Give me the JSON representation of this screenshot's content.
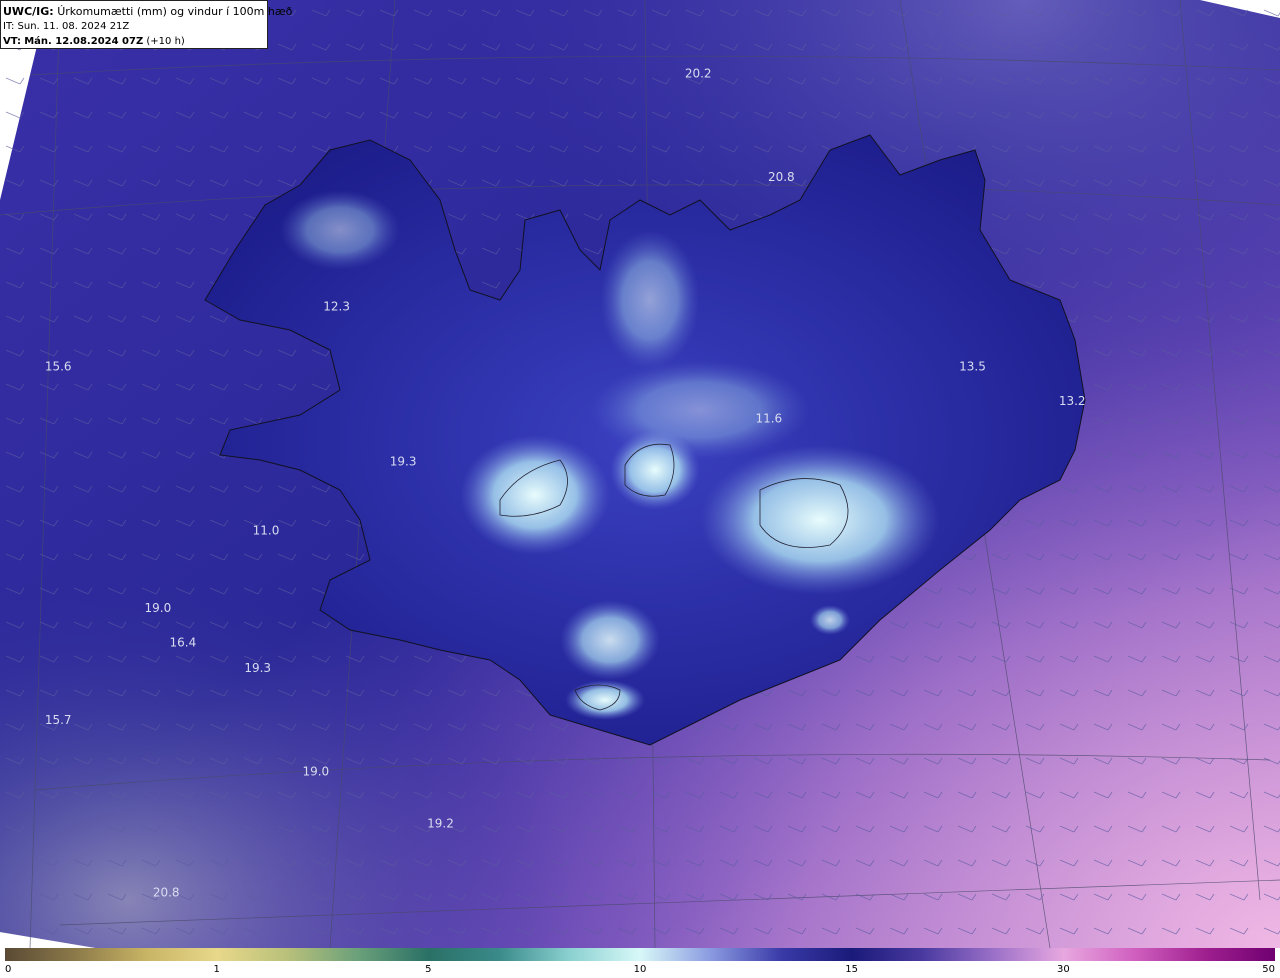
{
  "header": {
    "model": "UWC/IG:",
    "title": "Úrkomumætti (mm) og vindur í 100m hæð",
    "it_label": "IT:",
    "it_value": "Sun. 11. 08. 2024 21Z",
    "vt_label": "VT:",
    "vt_value": "Mán. 12.08.2024 07Z",
    "vt_offset": "(+10 h)"
  },
  "map": {
    "stations": [
      {
        "label": "20.2",
        "lon": -18.6,
        "lat": 67.45
      },
      {
        "label": "20.8",
        "lon": -17.6,
        "lat": 66.85
      },
      {
        "label": "12.3",
        "lon": -22.95,
        "lat": 66.1
      },
      {
        "label": "15.6",
        "lon": -26.3,
        "lat": 65.75
      },
      {
        "label": "13.5",
        "lon": -15.3,
        "lat": 65.75
      },
      {
        "label": "13.2",
        "lon": -14.1,
        "lat": 65.55
      },
      {
        "label": "19.3",
        "lon": -22.15,
        "lat": 65.2
      },
      {
        "label": "11.6",
        "lon": -17.75,
        "lat": 65.45
      },
      {
        "label": "11.0",
        "lon": -23.8,
        "lat": 64.8
      },
      {
        "label": "19.0",
        "lon": -25.1,
        "lat": 64.35
      },
      {
        "label": "16.4",
        "lon": -24.8,
        "lat": 64.15
      },
      {
        "label": "19.3",
        "lon": -23.9,
        "lat": 64.0
      },
      {
        "label": "15.7",
        "lon": -26.3,
        "lat": 63.7
      },
      {
        "label": "19.0",
        "lon": -23.2,
        "lat": 63.4
      },
      {
        "label": "19.2",
        "lon": -21.7,
        "lat": 63.1
      },
      {
        "label": "20.8",
        "lon": -25.0,
        "lat": 62.7
      }
    ]
  },
  "colorbar": {
    "ticks": [
      "0",
      "1",
      "5",
      "10",
      "15",
      "30",
      "50"
    ],
    "segments": [
      {
        "from": 0,
        "to": 1,
        "colors": [
          "#5a4a34",
          "#8c7a4a",
          "#c8b464",
          "#e8d88a"
        ]
      },
      {
        "from": 1,
        "to": 5,
        "colors": [
          "#e8d88a",
          "#b8c07a",
          "#6aa07a",
          "#2a7066"
        ]
      },
      {
        "from": 5,
        "to": 10,
        "colors": [
          "#2a7066",
          "#3a8a8a",
          "#8ad0d0",
          "#d8f8f8"
        ]
      },
      {
        "from": 10,
        "to": 15,
        "colors": [
          "#d8f8f8",
          "#8a9ae0",
          "#3a3aa8",
          "#1a1a7a"
        ]
      },
      {
        "from": 15,
        "to": 30,
        "colors": [
          "#1a1a7a",
          "#4a3aa0",
          "#9a70c8",
          "#e8a8e0"
        ]
      },
      {
        "from": 30,
        "to": 50,
        "colors": [
          "#e8a8e0",
          "#d060c0",
          "#a02090",
          "#700070"
        ]
      }
    ]
  }
}
